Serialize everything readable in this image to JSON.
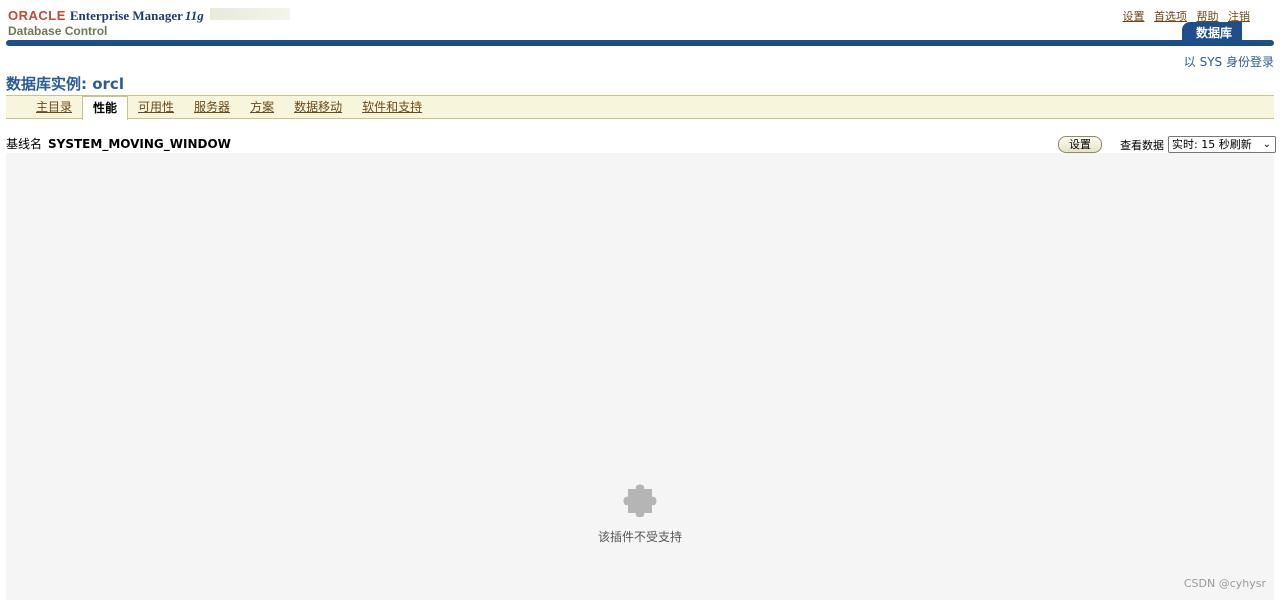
{
  "header": {
    "brand_oracle": "ORACLE",
    "brand_product": "Enterprise Manager",
    "brand_version": "11g",
    "brand_subtitle": "Database Control",
    "global_links": [
      "设置",
      "首选项",
      "帮助",
      "注销"
    ],
    "db_tab": "数据库",
    "login_as": "以 SYS 身份登录"
  },
  "page": {
    "title": "数据库实例: orcl"
  },
  "subtabs": [
    {
      "label": "主目录",
      "active": false
    },
    {
      "label": "性能",
      "active": true
    },
    {
      "label": "可用性",
      "active": false
    },
    {
      "label": "服务器",
      "active": false
    },
    {
      "label": "方案",
      "active": false
    },
    {
      "label": "数据移动",
      "active": false
    },
    {
      "label": "软件和支持",
      "active": false
    }
  ],
  "toolbar": {
    "baseline_label": "基线名",
    "baseline_value": "SYSTEM_MOVING_WINDOW",
    "settings_button": "设置",
    "view_data_label": "查看数据",
    "view_data_selected": "实时: 15 秒刷新"
  },
  "plugin": {
    "icon": "puzzle-piece-icon",
    "message": "该插件不受支持"
  },
  "watermark": "CSDN @cyhysr",
  "colors": {
    "brand_red": "#c74634",
    "brand_blue": "#1f4f8a",
    "link_brown": "#6b4a1b",
    "title_blue": "#2b5c94",
    "tabbar_bg": "#f7f6dc"
  }
}
